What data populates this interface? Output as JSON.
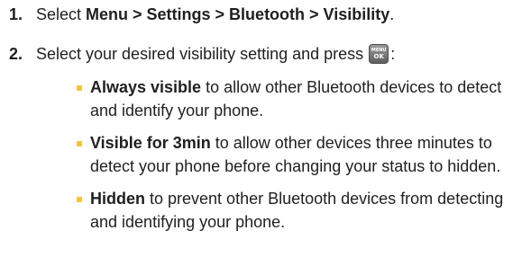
{
  "steps": [
    {
      "number": "1.",
      "text_before": "Select ",
      "bold": "Menu > Settings > Bluetooth > Visibility",
      "text_after": "."
    },
    {
      "number": "2.",
      "text_before": "Select your desired visibility setting and press ",
      "key": {
        "top": "MENU",
        "bottom": "OK",
        "icon": "menu-ok-key-icon"
      },
      "text_after": ":"
    }
  ],
  "options": [
    {
      "bold": "Always visible",
      "text": " to allow other Bluetooth devices to detect and identify your phone."
    },
    {
      "bold": "Visible for 3min",
      "text": " to allow other devices three minutes to detect your phone before changing your status to hidden."
    },
    {
      "bold": "Hidden",
      "text": " to prevent other Bluetooth devices from detecting and identifying your phone."
    }
  ],
  "colors": {
    "text": "#1f1f1f",
    "bullet": "#f6c347",
    "key": "#6f6f6f"
  }
}
